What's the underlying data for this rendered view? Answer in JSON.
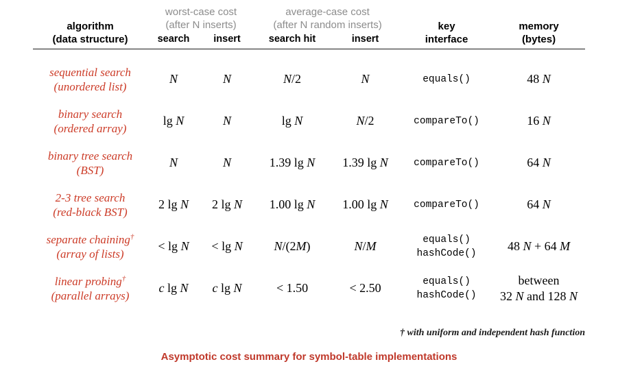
{
  "table": {
    "headers": {
      "algorithm": {
        "line1": "algorithm",
        "line2": "(data structure)"
      },
      "worst_case": {
        "group1": "worst-case cost",
        "group2": "(after N inserts)",
        "sub1": "search",
        "sub2": "insert"
      },
      "average_case": {
        "group1": "average-case cost",
        "group2": "(after N random inserts)",
        "sub1": "search hit",
        "sub2": "insert"
      },
      "key_interface": {
        "line1": "key",
        "line2": "interface"
      },
      "memory": {
        "line1": "memory",
        "line2": "(bytes)"
      }
    },
    "rows": [
      {
        "algo_line1": "sequential search",
        "algo_line2": "(unordered list)",
        "algo_dagger": "",
        "worst_search": "N",
        "worst_insert": "N",
        "avg_search_hit": "N/2",
        "avg_insert": "N",
        "key_interface_line1": "equals()",
        "key_interface_line2": "",
        "memory_line1": "48 N",
        "memory_line2": ""
      },
      {
        "algo_line1": "binary search",
        "algo_line2": "(ordered array)",
        "algo_dagger": "",
        "worst_search": "lg N",
        "worst_insert": "N",
        "avg_search_hit": "lg N",
        "avg_insert": "N/2",
        "key_interface_line1": "compareTo()",
        "key_interface_line2": "",
        "memory_line1": "16 N",
        "memory_line2": ""
      },
      {
        "algo_line1": "binary tree search",
        "algo_line2": "(BST)",
        "algo_dagger": "",
        "worst_search": "N",
        "worst_insert": "N",
        "avg_search_hit": "1.39 lg N",
        "avg_insert": "1.39 lg N",
        "key_interface_line1": "compareTo()",
        "key_interface_line2": "",
        "memory_line1": "64 N",
        "memory_line2": ""
      },
      {
        "algo_line1": "2-3 tree search",
        "algo_line2": "(red-black BST)",
        "algo_dagger": "",
        "worst_search": "2 lg N",
        "worst_insert": "2 lg N",
        "avg_search_hit": "1.00 lg N",
        "avg_insert": "1.00 lg N",
        "key_interface_line1": "compareTo()",
        "key_interface_line2": "",
        "memory_line1": "64 N",
        "memory_line2": ""
      },
      {
        "algo_line1": "separate chaining",
        "algo_line2": "(array of lists)",
        "algo_dagger": "†",
        "worst_search": "< lg N",
        "worst_insert": "< lg N",
        "avg_search_hit": "N/(2M)",
        "avg_insert": "N/M",
        "key_interface_line1": "equals()",
        "key_interface_line2": "hashCode()",
        "memory_line1": "48 N + 64 M",
        "memory_line2": ""
      },
      {
        "algo_line1": "linear probing",
        "algo_line2": "(parallel arrays)",
        "algo_dagger": "†",
        "worst_search": "c lg N",
        "worst_insert": "c lg N",
        "avg_search_hit": "< 1.50",
        "avg_insert": "< 2.50",
        "key_interface_line1": "equals()",
        "key_interface_line2": "hashCode()",
        "memory_line1": "between",
        "memory_line2": "32 N and 128 N"
      }
    ]
  },
  "footnote": "† with uniform and independent hash function",
  "caption": "Asymptotic cost summary for symbol-table implementations",
  "colors": {
    "algorithm_red": "#cc3b27",
    "caption_red": "#c0392b",
    "group_header_gray": "#8c8c8c",
    "rule_black": "#1a1a1a"
  }
}
